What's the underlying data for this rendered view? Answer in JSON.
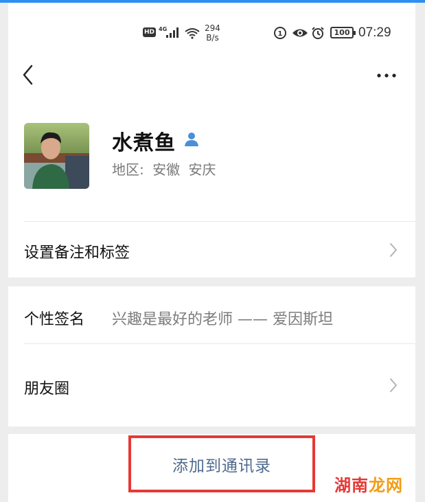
{
  "status_bar": {
    "hd": "HD",
    "network": "4G",
    "speed_value": "294",
    "speed_unit": "B/s",
    "battery": "100",
    "time": "07:29"
  },
  "nav": {
    "back_icon": "chevron-left-icon",
    "more_icon": "more-dots-icon"
  },
  "profile": {
    "name": "水煮鱼",
    "region_label": "地区:",
    "province": "安徽",
    "city": "安庆"
  },
  "rows": {
    "remark": "设置备注和标签",
    "signature_label": "个性签名",
    "signature_value": "兴趣是最好的老师 —— 爱因斯坦",
    "moments": "朋友圈"
  },
  "action": {
    "add_contact": "添加到通讯录"
  },
  "watermark": {
    "part1": "湖南",
    "part2": "龙网"
  },
  "colors": {
    "accent": "#2f8ff0",
    "highlight_border": "#e53935",
    "link_text": "#4f6a8f"
  }
}
